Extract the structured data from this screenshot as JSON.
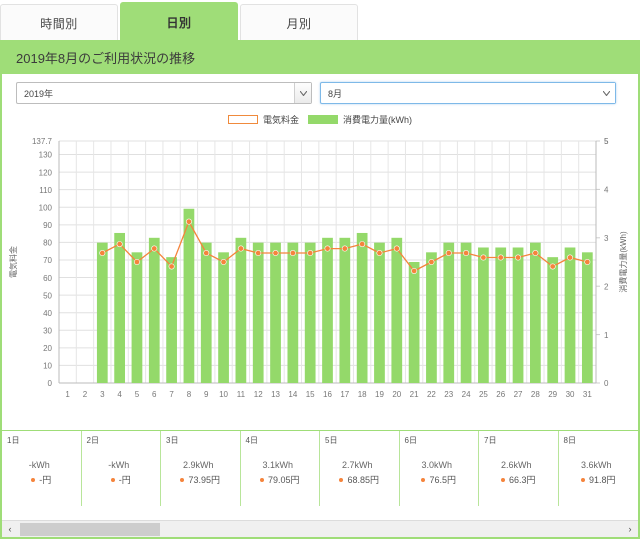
{
  "tabs": [
    {
      "label": "時間別",
      "active": false
    },
    {
      "label": "日別",
      "active": true
    },
    {
      "label": "月別",
      "active": false
    }
  ],
  "header": {
    "title": "2019年8月のご利用状況の推移"
  },
  "filters": {
    "year": {
      "value": "2019年",
      "icon": "chevron-down-icon"
    },
    "month": {
      "value": "8月",
      "icon": "chevron-down-icon"
    }
  },
  "legend": [
    {
      "label": "電気料金",
      "type": "line",
      "color": "#f08a3c"
    },
    {
      "label": "消費電力量(kWh)",
      "type": "bar",
      "color": "#94d96a"
    }
  ],
  "scrollbar": {
    "left_arrow": "‹",
    "right_arrow": "›"
  },
  "table": {
    "columns": [
      {
        "day": "1日",
        "kwh": "-kWh",
        "yen": "-円"
      },
      {
        "day": "2日",
        "kwh": "-kWh",
        "yen": "-円"
      },
      {
        "day": "3日",
        "kwh": "2.9kWh",
        "yen": "73.95円"
      },
      {
        "day": "4日",
        "kwh": "3.1kWh",
        "yen": "79.05円"
      },
      {
        "day": "5日",
        "kwh": "2.7kWh",
        "yen": "68.85円"
      },
      {
        "day": "6日",
        "kwh": "3.0kWh",
        "yen": "76.5円"
      },
      {
        "day": "7日",
        "kwh": "2.6kWh",
        "yen": "66.3円"
      },
      {
        "day": "8日",
        "kwh": "3.6kWh",
        "yen": "91.8円"
      }
    ]
  },
  "chart_data": {
    "type": "bar",
    "title": "2019年8月のご利用状況の推移",
    "xlabel": "",
    "ylabel": "電気料金",
    "y2label": "消費電力量(kWh)",
    "ylim": [
      0,
      137.7
    ],
    "y2lim": [
      0,
      5
    ],
    "yticks": [
      0,
      10,
      20,
      30,
      40,
      50,
      60,
      70,
      80,
      90,
      100,
      110,
      120,
      130,
      137.7
    ],
    "y2ticks": [
      0,
      1,
      2,
      3,
      4,
      5
    ],
    "ymax_label": "137.7",
    "y2max_label": "5",
    "grid": true,
    "legend_position": "top-center",
    "categories": [
      "1",
      "2",
      "3",
      "4",
      "5",
      "6",
      "7",
      "8",
      "9",
      "10",
      "11",
      "12",
      "13",
      "14",
      "15",
      "16",
      "17",
      "18",
      "19",
      "20",
      "21",
      "22",
      "23",
      "24",
      "25",
      "26",
      "27",
      "28",
      "29",
      "30",
      "31"
    ],
    "series": [
      {
        "name": "消費電力量(kWh)",
        "type": "bar",
        "axis": "right",
        "color": "#94d96a",
        "values": [
          null,
          null,
          2.9,
          3.1,
          2.7,
          3.0,
          2.6,
          3.6,
          2.9,
          2.7,
          3.0,
          2.9,
          2.9,
          2.9,
          2.9,
          3.0,
          3.0,
          3.1,
          2.9,
          3.0,
          2.5,
          2.7,
          2.9,
          2.9,
          2.8,
          2.8,
          2.8,
          2.9,
          2.6,
          2.8,
          2.7
        ]
      },
      {
        "name": "電気料金",
        "type": "line",
        "axis": "left",
        "color": "#f5843c",
        "values": [
          null,
          null,
          73.95,
          79.05,
          68.85,
          76.5,
          66.3,
          91.8,
          73.95,
          68.85,
          76.5,
          73.95,
          73.95,
          73.95,
          73.95,
          76.5,
          76.5,
          79.05,
          73.95,
          76.5,
          63.75,
          68.85,
          73.95,
          73.95,
          71.4,
          71.4,
          71.4,
          73.95,
          66.3,
          71.4,
          68.85
        ]
      }
    ]
  }
}
